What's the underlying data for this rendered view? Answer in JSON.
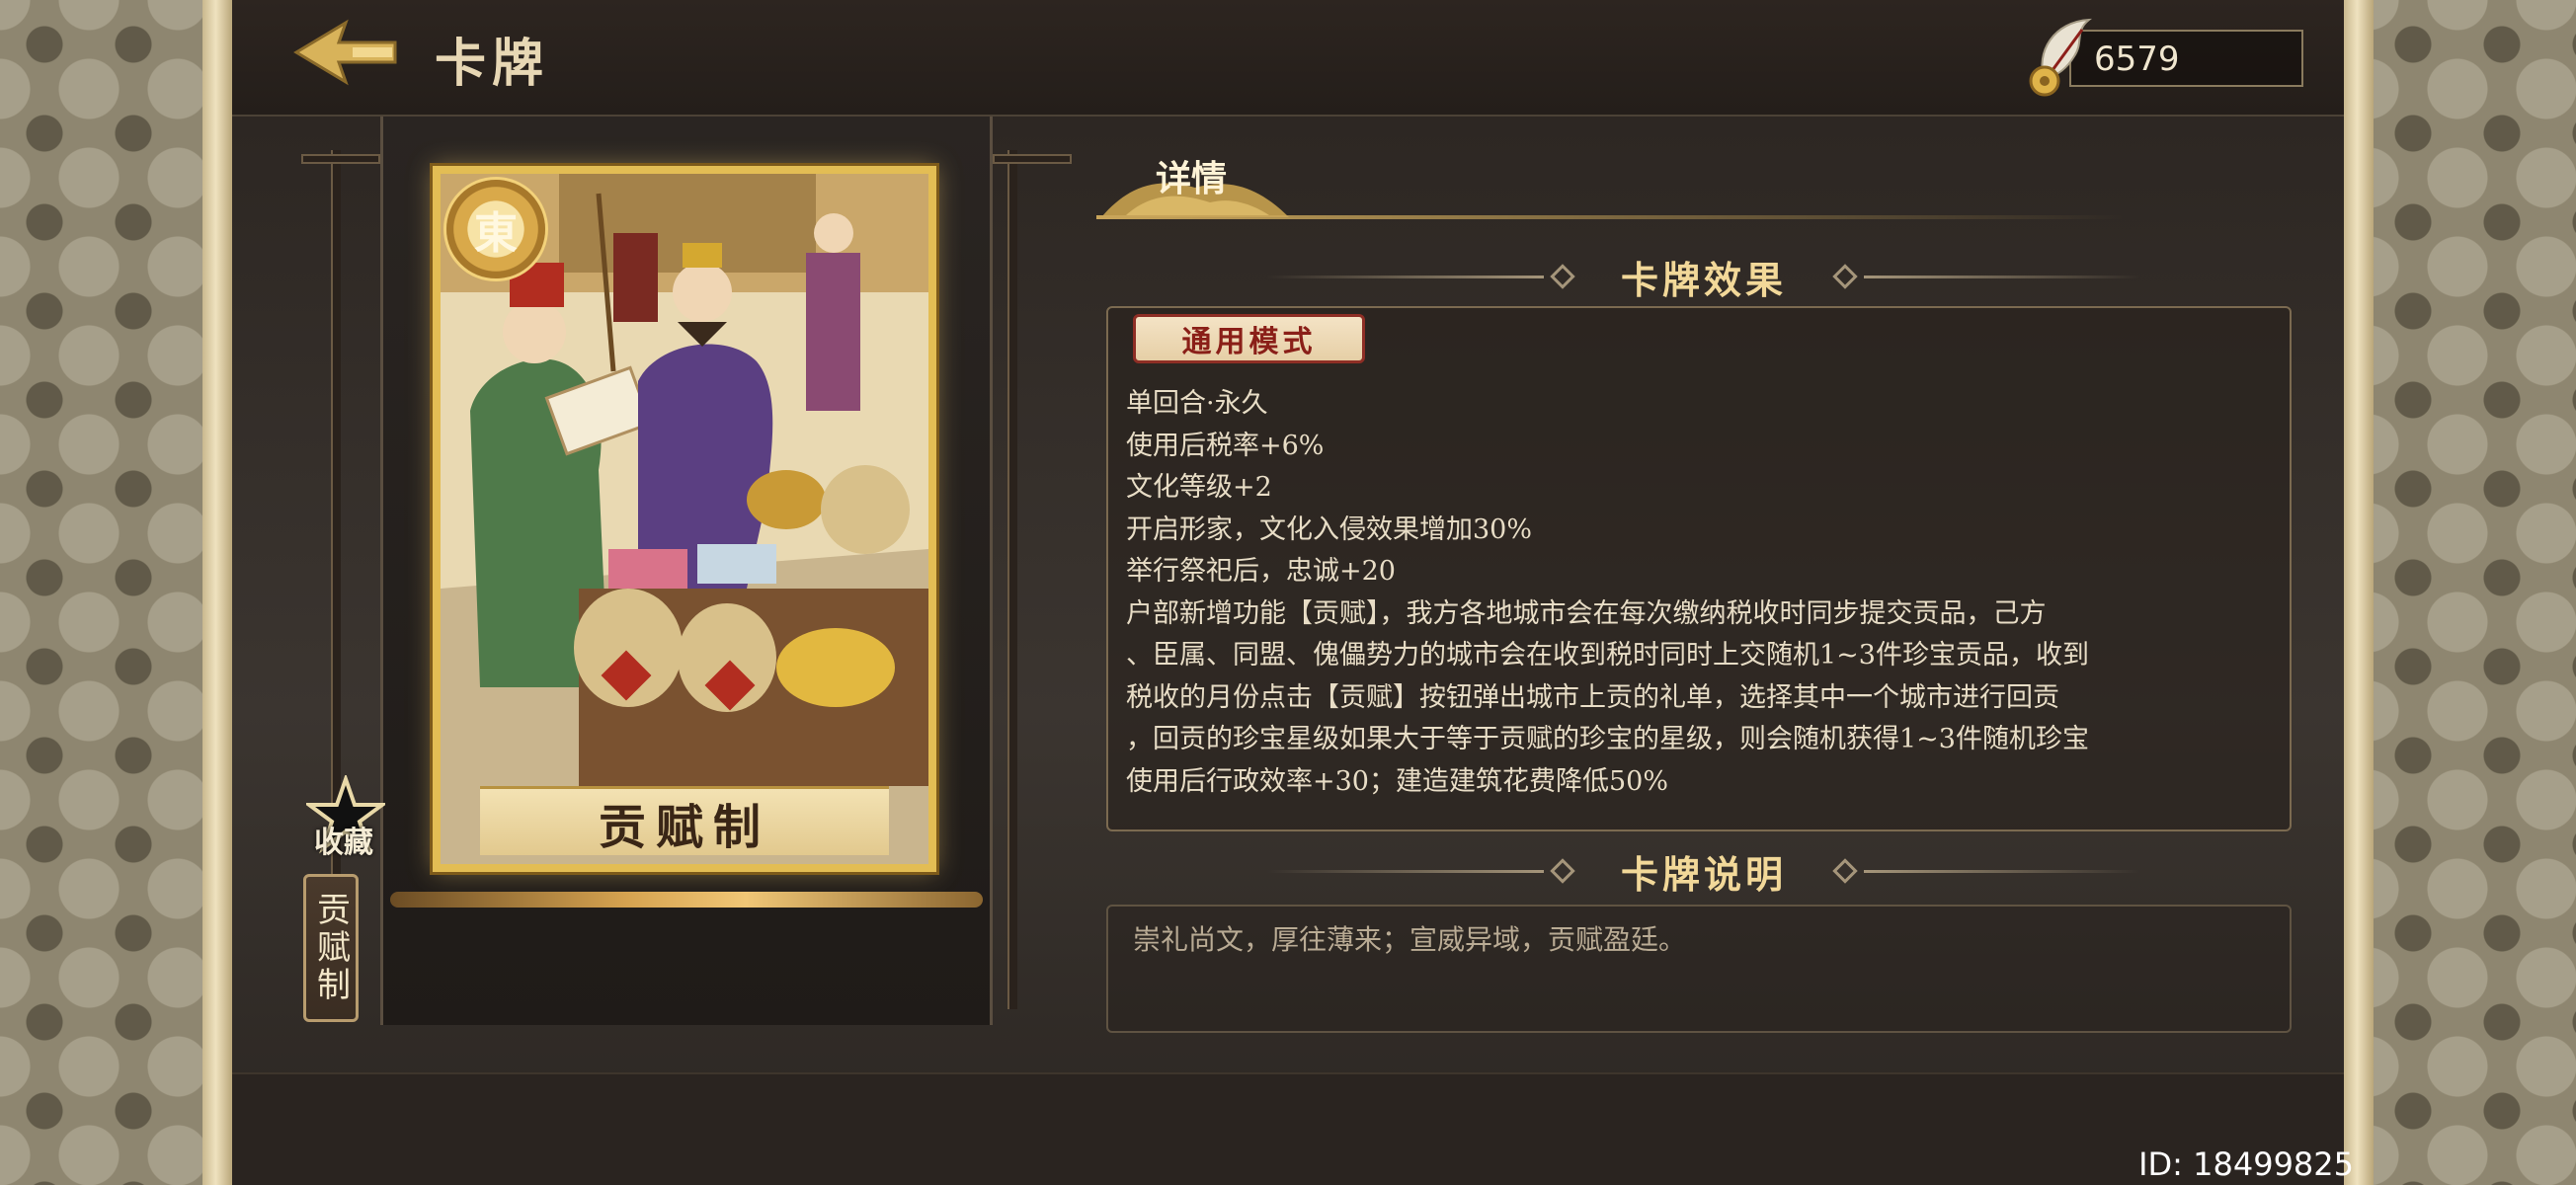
{
  "header": {
    "title": "卡牌",
    "currency_value": "6579"
  },
  "card": {
    "badge": "東",
    "name": "贡赋制",
    "favorite_label": "收藏",
    "name_tag": "贡赋制"
  },
  "tabs": {
    "details": "详情"
  },
  "effect": {
    "section_title": "卡牌效果",
    "mode_tag": "通用模式",
    "lines": [
      "单回合·永久",
      "使用后税率+6%",
      "文化等级+2",
      "开启形家，文化入侵效果增加30%",
      "举行祭祀后，忠诚+20",
      "户部新增功能【贡赋】，我方各地城市会在每次缴纳税收时同步提交贡品，己方",
      "、臣属、同盟、傀儡势力的城市会在收到税时同时上交随机1~3件珍宝贡品，收到",
      "税收的月份点击【贡赋】按钮弹出城市上贡的礼单，选择其中一个城市进行回贡",
      "，回贡的珍宝星级如果大于等于贡赋的珍宝的星级，则会随机获得1~3件随机珍宝",
      "使用后行政效率+30；建造建筑花费降低50%"
    ]
  },
  "description": {
    "section_title": "卡牌说明",
    "text": "崇礼尚文，厚往薄来；宣威异域，贡赋盈廷。"
  },
  "footer": {
    "id_label": "ID: 18499825"
  },
  "colors": {
    "accent_gold": "#e3bd54",
    "title_gold": "#f2d899",
    "mode_tag_red": "#8a1f18"
  },
  "icons": [
    "back-arrow-icon",
    "feather-coin-icon",
    "star-icon"
  ]
}
